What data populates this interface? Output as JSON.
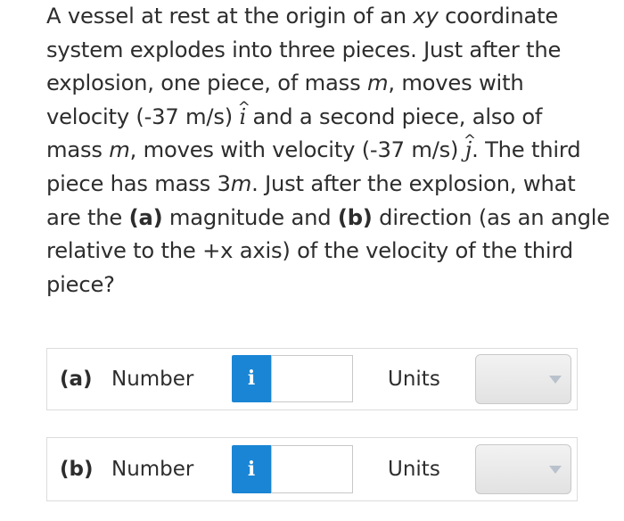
{
  "question": {
    "l1": "A vessel at rest at the origin of an ",
    "l1_var": "xy",
    "l1_end": " coordinate",
    "l2": "system explodes into three pieces. Just after the",
    "l3a": "explosion, one piece, of mass ",
    "l3_var": "m",
    "l3b": ", moves with",
    "l4a": "velocity (-37 m/s) ",
    "i_hat": "i",
    "l4b": " and a second piece, also of",
    "l5a": "mass ",
    "l5_var": "m",
    "l5b": ", moves with velocity (-37 m/s) ",
    "j_hat": "j",
    "l5c": ". The third",
    "l6a": "piece has mass 3",
    "l6_var": "m",
    "l6b": ". Just after the explosion, what",
    "l7a": "are the ",
    "part_a": "(a)",
    "l7b": " magnitude and ",
    "part_b": "(b)",
    "l7c": " direction (as an angle",
    "l8": "relative to the +x axis) of the velocity of the third",
    "l9": "piece?"
  },
  "answers": [
    {
      "part": "(a)",
      "label": "Number",
      "info": "i",
      "value": "",
      "units_label": "Units",
      "units_value": ""
    },
    {
      "part": "(b)",
      "label": "Number",
      "info": "i",
      "value": "",
      "units_label": "Units",
      "units_value": ""
    }
  ],
  "colors": {
    "info_button": "#1a85d4",
    "text": "#2d2d2d"
  }
}
